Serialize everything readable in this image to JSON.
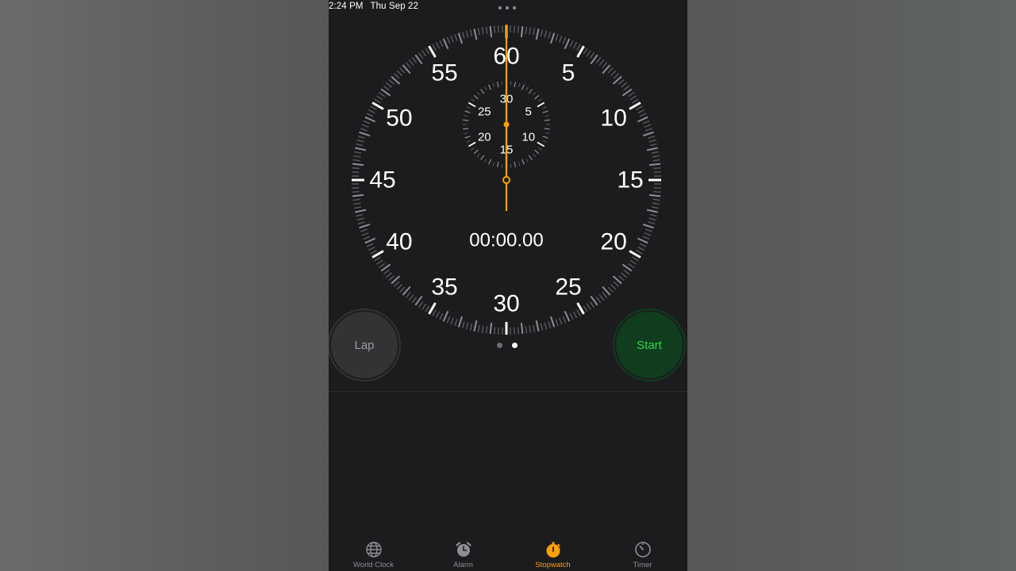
{
  "status_bar": {
    "time": "2:24 PM",
    "date": "Thu Sep 22"
  },
  "dial": {
    "main_numbers": [
      "60",
      "5",
      "10",
      "15",
      "20",
      "25",
      "30",
      "35",
      "40",
      "45",
      "50",
      "55"
    ],
    "sub_numbers": [
      "30",
      "5",
      "10",
      "15",
      "20",
      "25"
    ],
    "hand_color": "#ff9f0a",
    "readout": "00:00.00"
  },
  "controls": {
    "lap_label": "Lap",
    "start_label": "Start",
    "page_count": 2,
    "active_page": 2
  },
  "tabs": [
    {
      "label": "World Clock",
      "icon": "globe-icon",
      "active": false
    },
    {
      "label": "Alarm",
      "icon": "alarm-clock-icon",
      "active": false
    },
    {
      "label": "Stopwatch",
      "icon": "stopwatch-icon",
      "active": true
    },
    {
      "label": "Timer",
      "icon": "timer-icon",
      "active": false
    }
  ],
  "colors": {
    "accent": "#ff9f0a",
    "start_green": "#32d74b",
    "start_bg": "#0f3d1d",
    "background": "#1c1c1e"
  }
}
